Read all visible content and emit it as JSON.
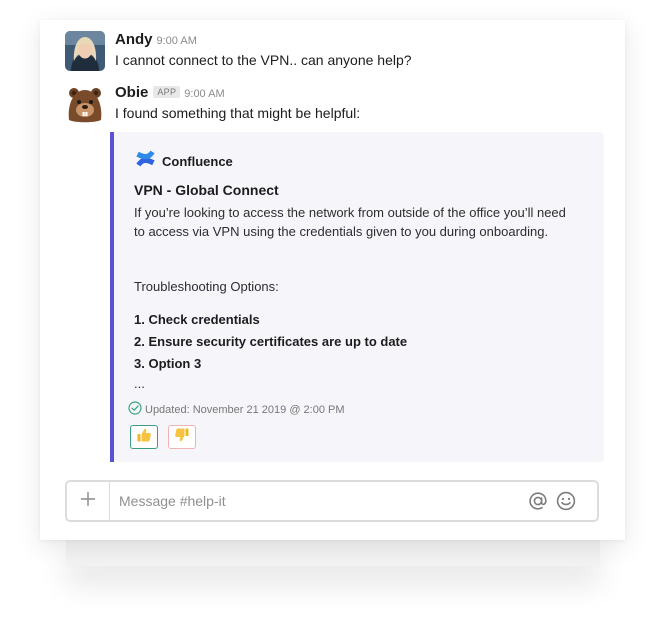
{
  "messages": [
    {
      "author": "Andy",
      "time": "9:00 AM",
      "text": "I cannot connect to the VPN.. can anyone help?"
    },
    {
      "author": "Obie",
      "badge": "APP",
      "time": "9:00 AM",
      "text": "I found something that might be helpful:"
    }
  ],
  "attachment": {
    "source": "Confluence",
    "title": "VPN - Global Connect",
    "description": "If you’re looking to access the network from outside of the office you’ll need to access via VPN using the credentials given to you during onboarding.",
    "troubleshooting_label": "Troubleshooting Options:",
    "items": [
      "1. Check credentials",
      "2. Ensure security certificates are up to date",
      "3. Option 3"
    ],
    "ellipsis": "...",
    "updated": "Updated: November 21 2019 @ 2:00 PM",
    "accent_color": "#5a52d6"
  },
  "composer": {
    "placeholder": "Message #help-it",
    "value": ""
  },
  "icons": {
    "add": "plus-icon",
    "mention": "at-icon",
    "emoji": "smile-icon",
    "vote_up": "thumbs-up-icon",
    "vote_down": "thumbs-down-icon",
    "updated": "check-circle-icon",
    "confluence": "confluence-logo-icon"
  }
}
